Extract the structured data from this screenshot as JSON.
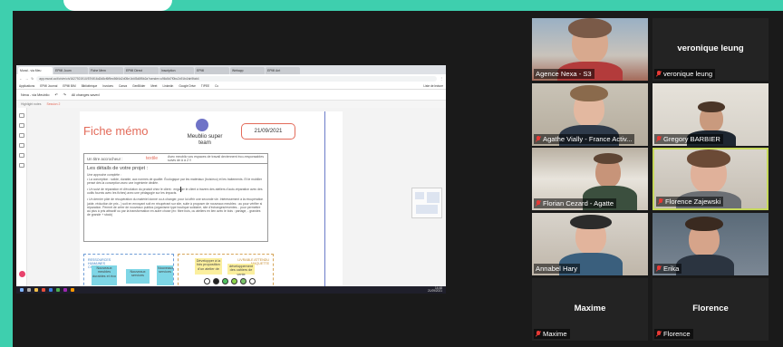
{
  "browser": {
    "tabs": [
      "Mural - via Meu",
      "EPMI Journ",
      "Fiche Mem",
      "EPMI Direct",
      "Inscription",
      "EPMI",
      "Webapp",
      "EPMI Ant"
    ],
    "url": "app.mural.co/t/ch/m/ch/1627921910/57f4f16d2d8cf6f9ec56f4d2d05e1b4f3d8f5b2a?sender=u96c5d7f0bc2c91b4/ah9fab4",
    "bookmarks": [
      "Applications",
      "EPMI Journal",
      "EPMI BIM",
      "Bibliothèque",
      "Invoices",
      "Canva",
      "GenBilder",
      "Meet",
      "Linkedin",
      "Google Drive",
      "TIPEE",
      "Cc"
    ],
    "bookmarks_right": "Liste de lecture"
  },
  "mural": {
    "board_name": "Nexa - via Meublio",
    "status": "All changes saved",
    "sub_left": "Highlight notes",
    "sub_mid": "Session 2"
  },
  "board": {
    "title": "Fiche mémo",
    "team": "Meublio super team",
    "date": "21/09/2021",
    "title_row_label": "Un titre accrocheur :",
    "title_row_value": "textile",
    "title_row_desc": "Avec meublio vos espaces de travail deviennent éco-responsables suivis de A à Z !!",
    "details_heading": "Les détails de votre projet :",
    "approach": "Une approche complète :",
    "bullet1": "• La conception : solide, durable, aux normes de qualité. Écologique par les matériaux (bois/eco) et les traitements. Et le mobilier pensé dès la conception avec une ingénierie dédiée.",
    "bullet2": "• Un suivi de réparation et d'évolution du produit chez le client : engager le client à travers des ateliers d'auto-réparation avec des outils fournis avec les fiches) avec une pédagogie sur les impacts.",
    "bullet3": "• Un dernier pôle de récupération du matériel donné ou à changer, pour lui offrir une seconde vie. Intéressement à la récupération (aide, réduction de prix...) soit en envoyant soit en récupérant sur site, suite à proposer de nouveaux meubles : au pour vérifier si réparation. Permet de créer de nouveaux publics (organisme type boutique solidaire, site d'échanges/reventes... pour permettre au plus à pris attractif ou par la transformation en autre chose (ex: fibre bois, ou ateliers en lien avec le bois : partage, - grandes de grande + stock)",
    "sec_a_label": "RESSOURCES HUMAINES CIBLÉES",
    "sec_b_label": "LIVRABLE ATTENDU MAQUETTE",
    "sticky1": "Nouveaux meubles durables et éco",
    "sticky2": "Nouveaux services",
    "sticky3": "Nouveaux services",
    "sticky4": "Développer à la fois proposition d'un atelier de",
    "sticky5": "développement des cahiers de vente"
  },
  "taskbar": {
    "time": "14:48",
    "date": "21/09/2021"
  },
  "participants": [
    {
      "name": "Agence Nexa - S3",
      "video": true
    },
    {
      "name": "veronique leung",
      "video": false,
      "center_name": "veronique leung"
    },
    {
      "name": "Agathe Vially - France Activ...",
      "video": true
    },
    {
      "name": "Gregory BARBIER",
      "video": true
    },
    {
      "name": "Florian Cezard - Agatte",
      "video": true
    },
    {
      "name": "Florence Zajewski",
      "video": true,
      "active": true
    },
    {
      "name": "Annabel Hary",
      "video": true
    },
    {
      "name": "Erika",
      "video": true
    },
    {
      "name": "Maxime",
      "video": false,
      "center_name": "Maxime"
    },
    {
      "name": "Florence",
      "video": false,
      "center_name": "Florence"
    }
  ],
  "colors": {
    "background": "#3ecfae",
    "frame": "#1a1a1a",
    "mic_muted": "#e53935",
    "active_border": "#c6d85b",
    "fiche_accent": "#e36b5a"
  }
}
